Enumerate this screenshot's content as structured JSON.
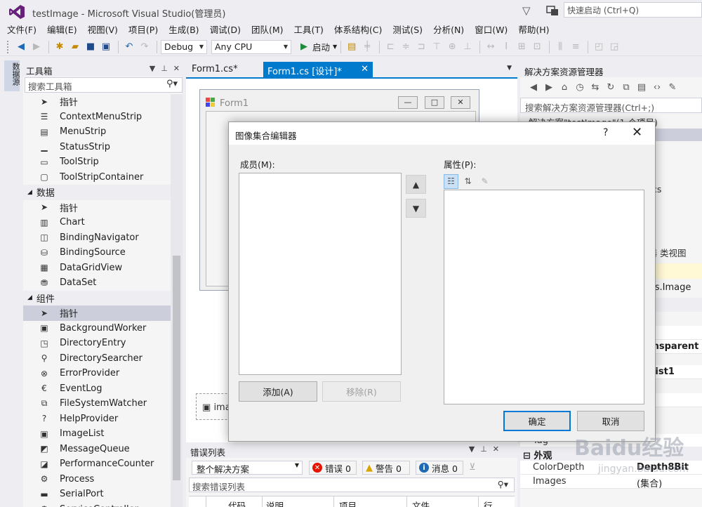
{
  "window": {
    "title": "testImage - Microsoft Visual Studio(管理员)",
    "quick_launch_placeholder": "快速启动 (Ctrl+Q)"
  },
  "menu": [
    "文件(F)",
    "编辑(E)",
    "视图(V)",
    "项目(P)",
    "生成(B)",
    "调试(D)",
    "团队(M)",
    "工具(T)",
    "体系结构(C)",
    "测试(S)",
    "分析(N)",
    "窗口(W)",
    "帮助(H)"
  ],
  "toolbar": {
    "config": "Debug",
    "platform": "Any CPU",
    "start_label": "启动"
  },
  "left_strip": {
    "tab": "数据源"
  },
  "toolbox": {
    "title": "工具箱",
    "search_placeholder": "搜索工具箱",
    "items": [
      {
        "type": "item",
        "label": "指针",
        "icon": "pointer-icon"
      },
      {
        "type": "item",
        "label": "ContextMenuStrip",
        "icon": "context-menu-icon"
      },
      {
        "type": "item",
        "label": "MenuStrip",
        "icon": "menu-strip-icon"
      },
      {
        "type": "item",
        "label": "StatusStrip",
        "icon": "status-strip-icon"
      },
      {
        "type": "item",
        "label": "ToolStrip",
        "icon": "tool-strip-icon"
      },
      {
        "type": "item",
        "label": "ToolStripContainer",
        "icon": "tool-strip-container-icon"
      },
      {
        "type": "group",
        "label": "数据"
      },
      {
        "type": "item",
        "label": "指针",
        "icon": "pointer-icon"
      },
      {
        "type": "item",
        "label": "Chart",
        "icon": "chart-icon"
      },
      {
        "type": "item",
        "label": "BindingNavigator",
        "icon": "binding-navigator-icon"
      },
      {
        "type": "item",
        "label": "BindingSource",
        "icon": "binding-source-icon"
      },
      {
        "type": "item",
        "label": "DataGridView",
        "icon": "data-grid-view-icon"
      },
      {
        "type": "item",
        "label": "DataSet",
        "icon": "data-set-icon"
      },
      {
        "type": "group",
        "label": "组件"
      },
      {
        "type": "item",
        "label": "指针",
        "icon": "pointer-icon",
        "selected": true
      },
      {
        "type": "item",
        "label": "BackgroundWorker",
        "icon": "background-worker-icon"
      },
      {
        "type": "item",
        "label": "DirectoryEntry",
        "icon": "directory-entry-icon"
      },
      {
        "type": "item",
        "label": "DirectorySearcher",
        "icon": "directory-searcher-icon"
      },
      {
        "type": "item",
        "label": "ErrorProvider",
        "icon": "error-provider-icon"
      },
      {
        "type": "item",
        "label": "EventLog",
        "icon": "event-log-icon"
      },
      {
        "type": "item",
        "label": "FileSystemWatcher",
        "icon": "file-system-watcher-icon"
      },
      {
        "type": "item",
        "label": "HelpProvider",
        "icon": "help-provider-icon"
      },
      {
        "type": "item",
        "label": "ImageList",
        "icon": "image-list-icon"
      },
      {
        "type": "item",
        "label": "MessageQueue",
        "icon": "message-queue-icon"
      },
      {
        "type": "item",
        "label": "PerformanceCounter",
        "icon": "performance-counter-icon"
      },
      {
        "type": "item",
        "label": "Process",
        "icon": "process-icon"
      },
      {
        "type": "item",
        "label": "SerialPort",
        "icon": "serial-port-icon"
      },
      {
        "type": "item",
        "label": "ServiceController",
        "icon": "service-controller-icon"
      }
    ]
  },
  "editor": {
    "tabs": [
      "Form1.cs*",
      "Form1.cs [设计]*"
    ],
    "form_title": "Form1",
    "tray_item": "imageList1"
  },
  "error_list": {
    "title": "错误列表",
    "scope": "整个解决方案",
    "errors": "错误 0",
    "warnings": "警告 0",
    "messages": "消息 0",
    "search_placeholder": "搜索错误列表",
    "columns": [
      "代码",
      "说明",
      "项目",
      "文件",
      "行"
    ]
  },
  "solution_explorer": {
    "title": "解决方案资源管理器",
    "search_placeholder": "搜索解决方案资源管理器(Ctrl+;)",
    "tree_row": "解决方案\"testImage\"(1 个项目)",
    "fragment": "cs"
  },
  "properties": {
    "tabs": "理器  类视图",
    "object": "orms.Image",
    "rows": [
      {
        "name": "",
        "value": "16"
      },
      {
        "name": "",
        "value": "Transparent"
      },
      {
        "name": "",
        "value": "geList1"
      },
      {
        "name": "",
        "value": "ate"
      },
      {
        "name": "Tag",
        "value": ""
      }
    ],
    "category": "外观",
    "color_depth_name": "ColorDepth",
    "color_depth_value": "Depth8Bit",
    "images_name": "Images",
    "images_value": "(集合)"
  },
  "dialog": {
    "title": "图像集合编辑器",
    "help": "?",
    "members_label": "成员(M):",
    "properties_label": "属性(P):",
    "add_button": "添加(A)",
    "remove_button": "移除(R)",
    "ok_button": "确定",
    "cancel_button": "取消"
  },
  "watermark": {
    "text": "Baidu经验",
    "sub": "jingyan.baidu.com"
  },
  "colors": {
    "accent": "#007acc",
    "selection": "#cccedb",
    "chrome": "#eeeef2"
  }
}
